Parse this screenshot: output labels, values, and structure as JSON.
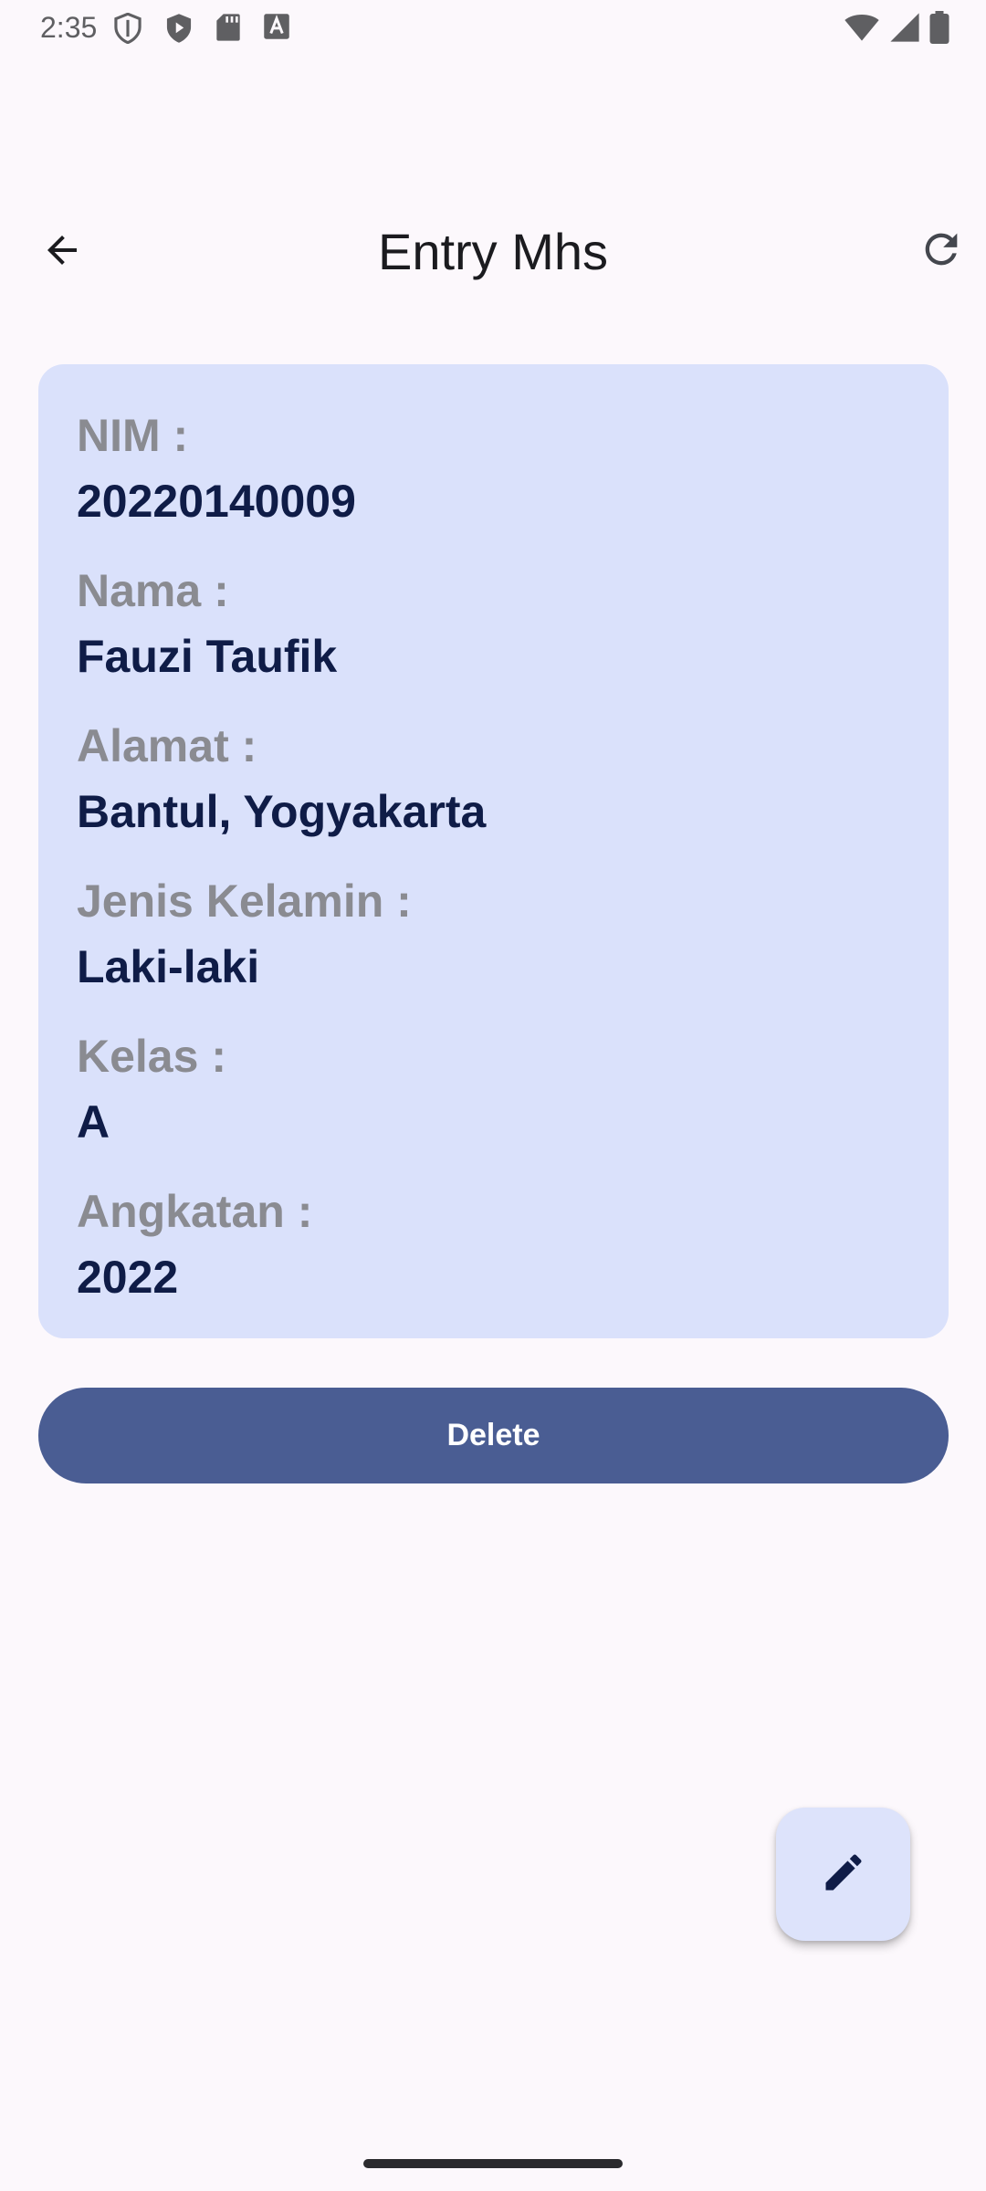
{
  "status_bar": {
    "time": "2:35",
    "left_icons": [
      "vpn-shield-icon",
      "play-shield-icon",
      "sd-card-icon",
      "font-a-icon"
    ],
    "right_icons": [
      "wifi-icon",
      "signal-icon",
      "battery-icon"
    ]
  },
  "app_bar": {
    "title": "Entry Mhs",
    "back_icon": "arrow-back-icon",
    "refresh_icon": "refresh-icon"
  },
  "detail": {
    "fields": [
      {
        "label": "NIM :",
        "value": "20220140009"
      },
      {
        "label": "Nama :",
        "value": "Fauzi Taufik"
      },
      {
        "label": "Alamat :",
        "value": "Bantul, Yogyakarta"
      },
      {
        "label": "Jenis Kelamin :",
        "value": "Laki-laki"
      },
      {
        "label": "Kelas :",
        "value": "A"
      },
      {
        "label": "Angkatan :",
        "value": "2022"
      }
    ]
  },
  "actions": {
    "delete_label": "Delete",
    "edit_icon": "pencil-icon"
  },
  "colors": {
    "background": "#fcf8fc",
    "card": "#dae1fb",
    "primary": "#4a5d93",
    "label": "#8a8b91",
    "value": "#0f1c47"
  }
}
